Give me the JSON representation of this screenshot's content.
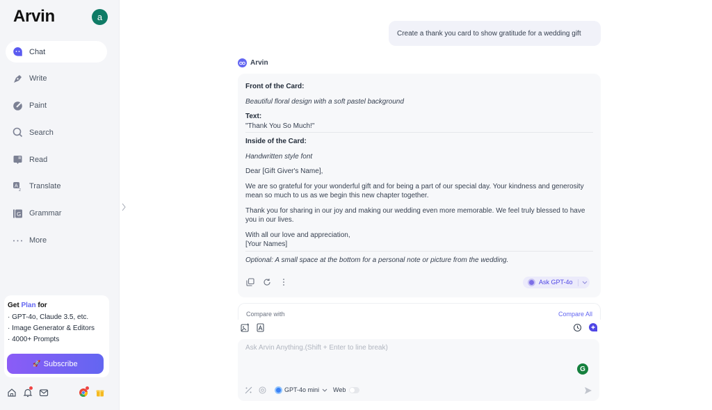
{
  "sidebar": {
    "logo": "Arvin",
    "avatar_initial": "a",
    "items": [
      {
        "label": "Chat",
        "icon": "chat-bubble-icon",
        "active": true
      },
      {
        "label": "Write",
        "icon": "pen-icon",
        "active": false
      },
      {
        "label": "Paint",
        "icon": "paint-brush-icon",
        "active": false
      },
      {
        "label": "Search",
        "icon": "search-icon",
        "active": false
      },
      {
        "label": "Read",
        "icon": "book-icon",
        "active": false
      },
      {
        "label": "Translate",
        "icon": "translate-icon",
        "active": false
      },
      {
        "label": "Grammar",
        "icon": "grammar-icon",
        "active": false
      },
      {
        "label": "More",
        "icon": "more-dots-icon",
        "active": false
      }
    ],
    "promo": {
      "title_prefix": "Get",
      "title_plan": "Plan",
      "title_suffix": "for",
      "lines": [
        "· GPT-4o, Claude 3.5, etc.",
        "· Image Generator & Editors",
        "· 4000+ Prompts"
      ],
      "subscribe_label": "Subscribe",
      "subscribe_emoji": "🚀"
    },
    "bottom_icons": [
      "home-icon",
      "bell-icon",
      "mail-icon",
      "chrome-icon",
      "gift-icon"
    ]
  },
  "chat": {
    "user_message": "Create a thank you card to show gratitude for a wedding gift",
    "bot_name": "Arvin",
    "response": {
      "front_heading": "Front of the Card:",
      "front_design": "Beautiful floral design with a soft pastel background",
      "text_label": "Text:",
      "text_value": "\"Thank You So Much!\"",
      "inside_heading": "Inside of the Card:",
      "inside_font": "Handwritten style font",
      "greeting": "Dear [Gift Giver's Name],",
      "para1": "We are so grateful for your wonderful gift and for being a part of our special day. Your kindness and generosity mean so much to us as we begin this new chapter together.",
      "para2": "Thank you for sharing in our joy and making our wedding even more memorable. We feel truly blessed to have you in our lives.",
      "closing": "With all our love and appreciation,",
      "signature": "[Your Names]",
      "optional": "Optional: A small space at the bottom for a personal note or picture from the wedding."
    },
    "ask_button": "Ask GPT-4o"
  },
  "compare": {
    "label": "Compare with",
    "compare_all": "Compare All"
  },
  "composer": {
    "placeholder": "Ask Arvin Anything.(Shift + Enter to line break)",
    "value": "",
    "model": "GPT-4o mini",
    "web_label": "Web",
    "web_enabled": false
  },
  "colors": {
    "accent": "#6366f1",
    "avatar": "#0f7b66"
  }
}
